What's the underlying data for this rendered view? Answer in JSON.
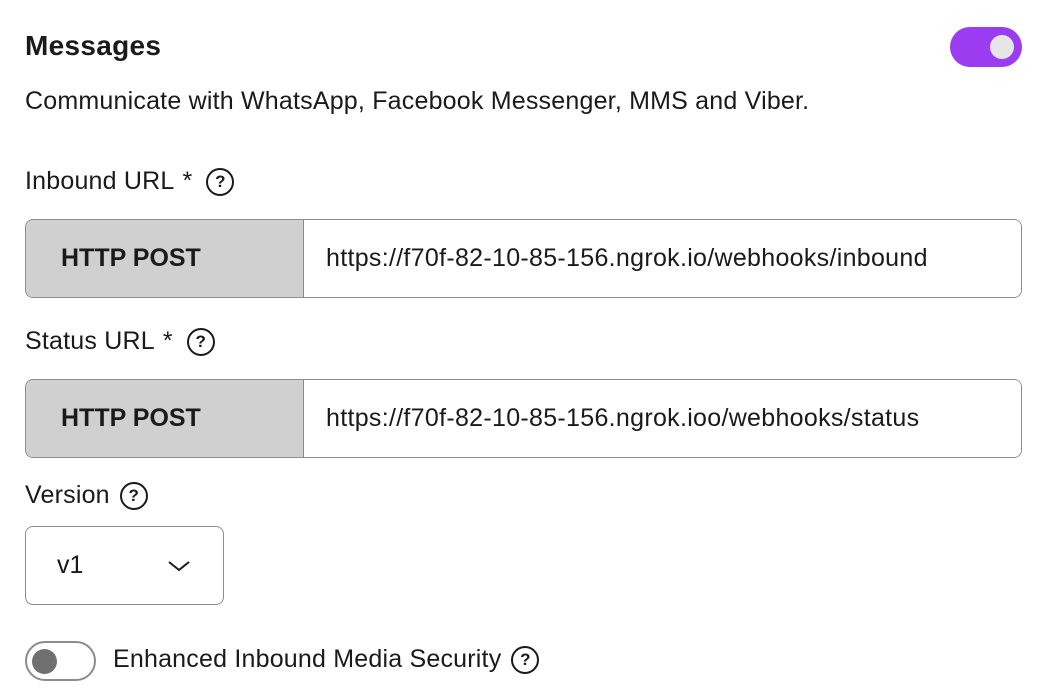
{
  "messages": {
    "title": "Messages",
    "enabled": true,
    "description": "Communicate with WhatsApp, Facebook Messenger, MMS and Viber.",
    "accent_color": "#9b3cf0"
  },
  "inbound": {
    "label": "Inbound URL",
    "required_mark": "*",
    "help_glyph": "?",
    "method": "HTTP POST",
    "url": "https://f70f-82-10-85-156.ngrok.io/webhooks/inbound"
  },
  "status": {
    "label": "Status URL",
    "required_mark": "*",
    "help_glyph": "?",
    "method": "HTTP POST",
    "url": "https://f70f-82-10-85-156.ngrok.ioo/webhooks/status"
  },
  "version": {
    "label": "Version",
    "help_glyph": "?",
    "selected": "v1"
  },
  "enhanced_security": {
    "label": "Enhanced Inbound Media Security",
    "help_glyph": "?",
    "enabled": false
  }
}
